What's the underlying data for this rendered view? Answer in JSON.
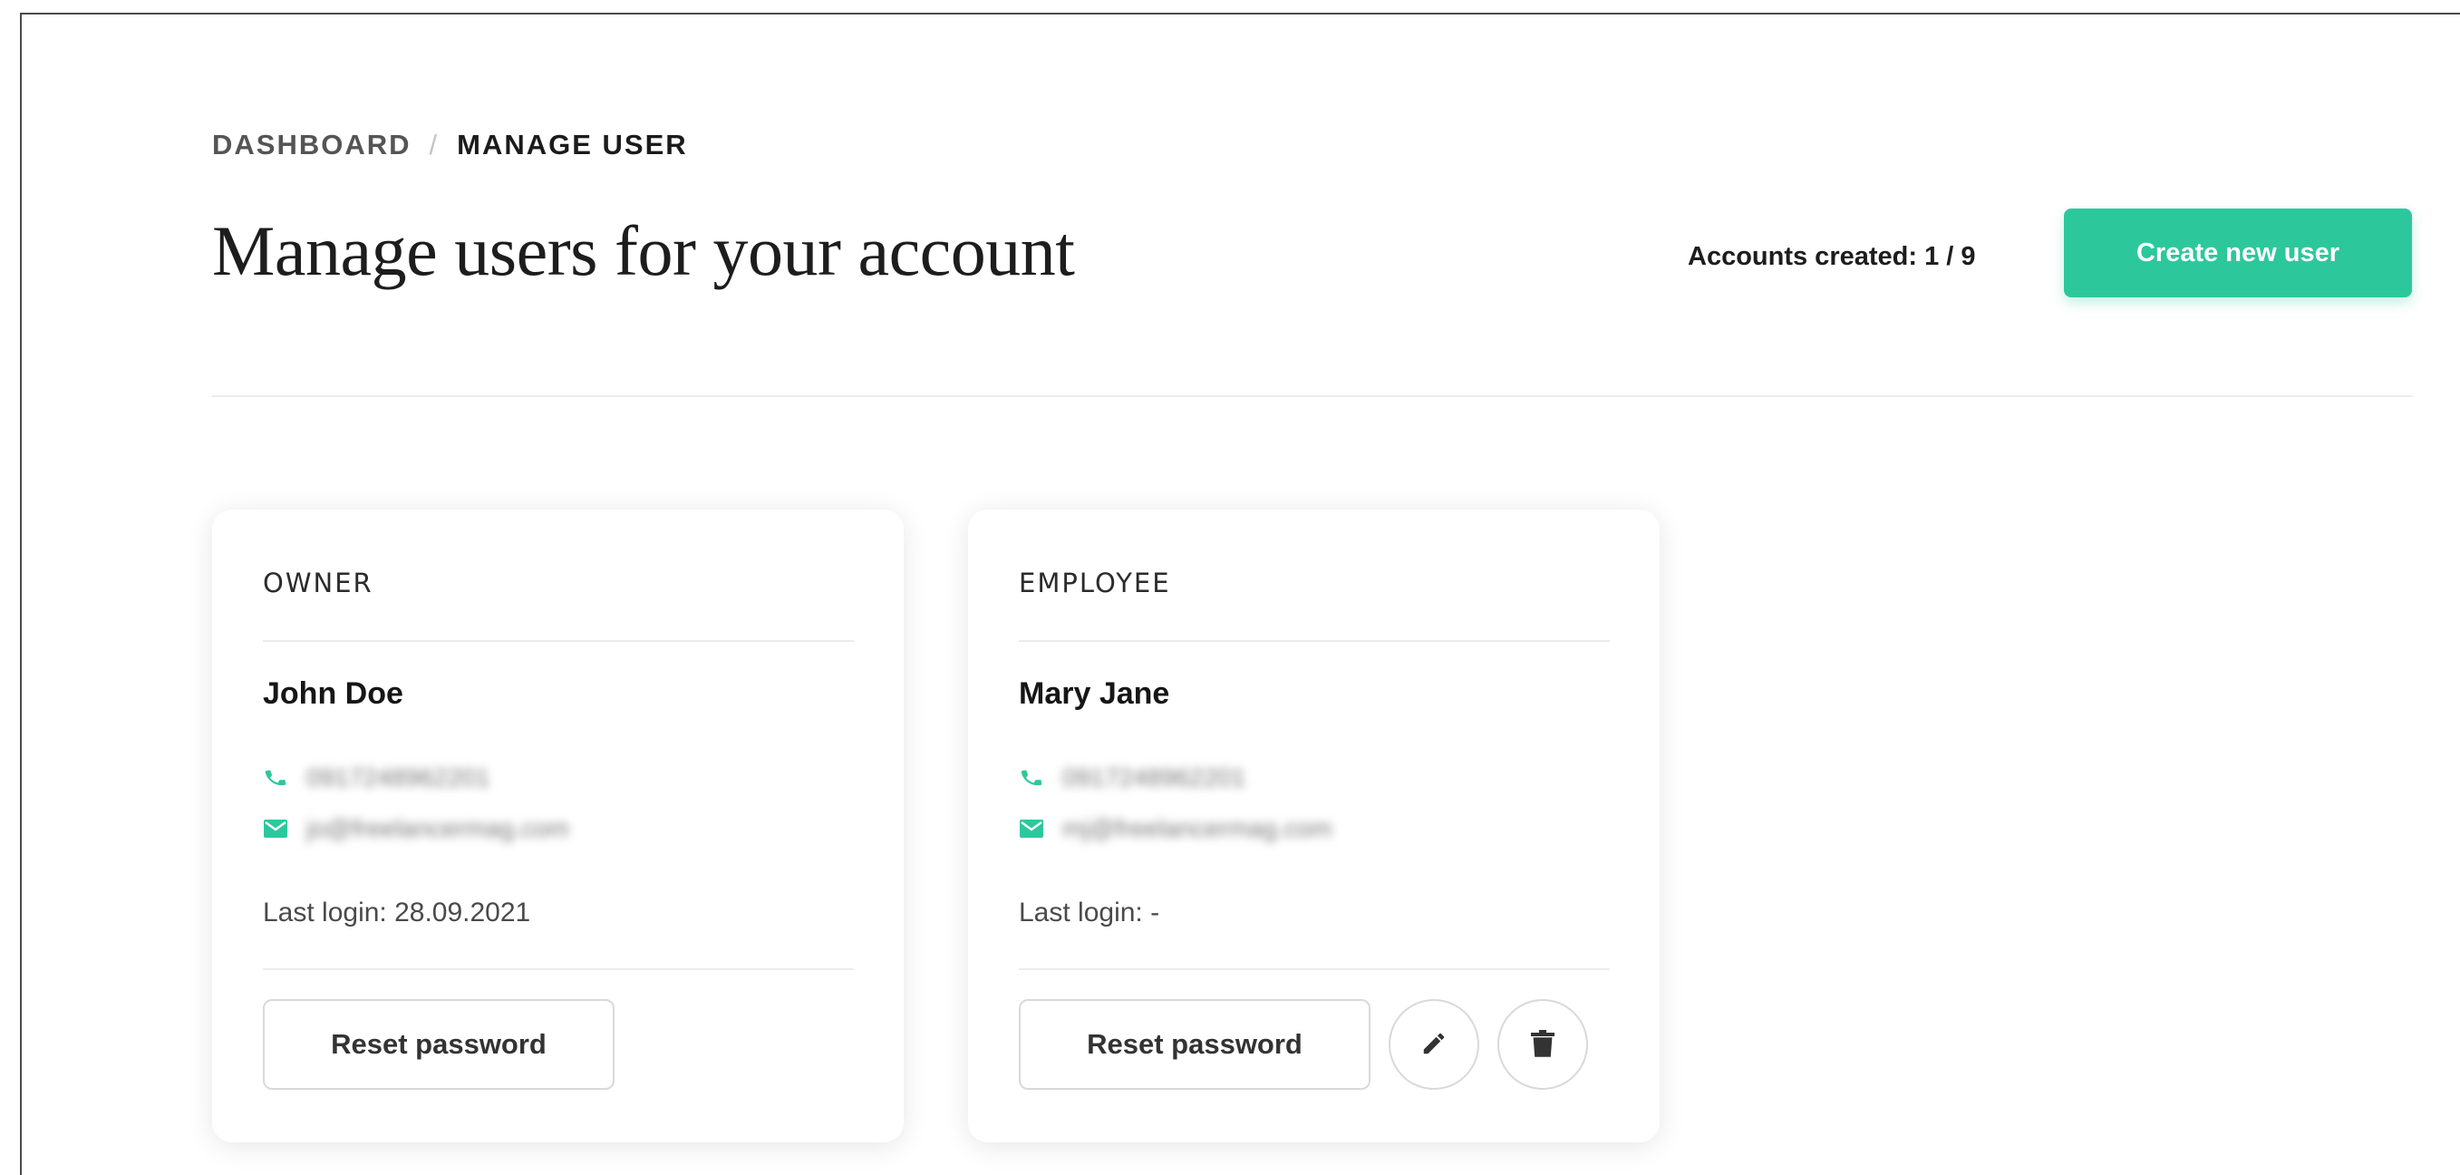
{
  "breadcrumb": {
    "dashboard": "DASHBOARD",
    "separator": "/",
    "current": "MANAGE USER"
  },
  "header": {
    "title": "Manage users for your account",
    "accounts_created": "Accounts created: 1 / 9",
    "create_button": "Create new user"
  },
  "colors": {
    "accent": "#2cc89c",
    "text": "#1d1d1d",
    "muted": "#4a4a4a"
  },
  "icons": {
    "phone": "phone-icon",
    "email": "envelope-icon",
    "edit": "pencil-icon",
    "delete": "trash-icon"
  },
  "users": [
    {
      "role": "OWNER",
      "name": "John Doe",
      "phone": "0917248962201",
      "email": "jo@freelancermag.com",
      "last_login": "Last login: 28.09.2021",
      "reset_label": "Reset password"
    },
    {
      "role": "EMPLOYEE",
      "name": "Mary Jane",
      "phone": "0917248962201",
      "email": "mj@freelancermag.com",
      "last_login": "Last login: -",
      "reset_label": "Reset password"
    }
  ]
}
